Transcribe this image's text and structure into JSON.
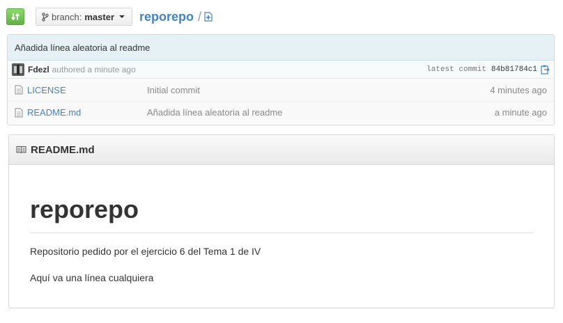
{
  "toolbar": {
    "branch_prefix": "branch:",
    "branch_name": "master",
    "repo_name": "reporepo",
    "path_separator": "/"
  },
  "commit": {
    "message": "Añadida línea aleatoria al readme",
    "author": "Fdezl",
    "authored_text": "authored a minute ago",
    "latest_label": "latest commit",
    "sha": "84b81784c1"
  },
  "files": [
    {
      "icon": "file-icon",
      "name": "LICENSE",
      "message": "Initial commit",
      "age": "4 minutes ago"
    },
    {
      "icon": "file-icon",
      "name": "README.md",
      "message": "Añadida línea aleatoria al readme",
      "age": "a minute ago"
    }
  ],
  "readme": {
    "filename": "README.md",
    "heading": "reporepo",
    "paragraphs": [
      "Repositorio pedido por el ejercicio 6 del Tema 1 de IV",
      "Aquí va una línea cualquiera"
    ]
  },
  "colors": {
    "link": "#4183c4",
    "compare_button": "#60b044",
    "commit_bar": "#e6f1f6"
  }
}
